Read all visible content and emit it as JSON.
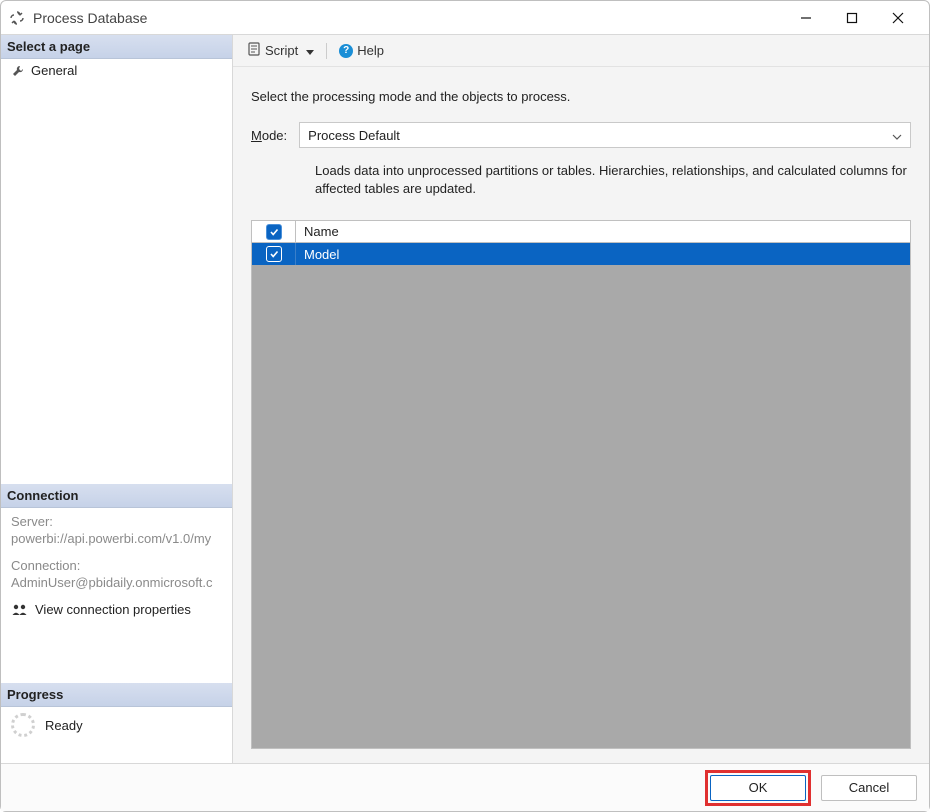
{
  "window": {
    "title": "Process Database"
  },
  "sidebar": {
    "select_page_header": "Select a page",
    "general_label": "General",
    "connection_header": "Connection",
    "server_label": "Server:",
    "server_value": "powerbi://api.powerbi.com/v1.0/my",
    "connection_label": "Connection:",
    "connection_value": "AdminUser@pbidaily.onmicrosoft.c",
    "view_connection_properties": "View connection properties",
    "progress_header": "Progress",
    "progress_status": "Ready"
  },
  "toolbar": {
    "script_label": "Script",
    "help_label": "Help"
  },
  "main": {
    "instruction": "Select the processing mode and the objects to process.",
    "mode_label_prefix": "M",
    "mode_label_rest": "ode:",
    "mode_selected": "Process Default",
    "mode_description": "Loads data into unprocessed partitions or tables. Hierarchies, relationships, and calculated columns for affected tables are updated.",
    "table": {
      "header_name": "Name",
      "rows": [
        {
          "name": "Model",
          "checked": true
        }
      ]
    }
  },
  "footer": {
    "ok_label": "OK",
    "cancel_label": "Cancel"
  }
}
